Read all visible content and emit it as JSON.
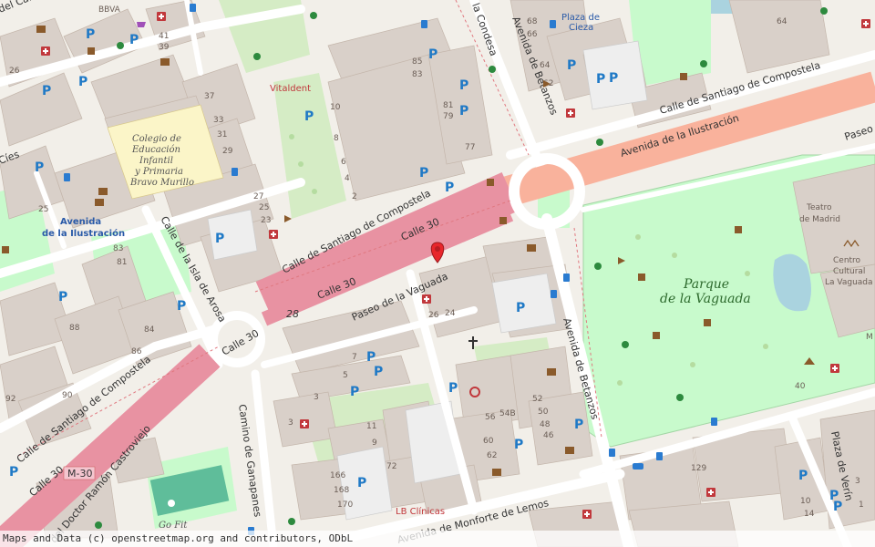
{
  "streets": {
    "calle_cardenal": "del Carden",
    "calle_condesa": "la Condesa",
    "avenida_betanzos_top": "Avenida de Betanzos",
    "calle_santiago_top": "Calle de Santiago de Compostela",
    "avenida_ilustracion_top": "Avenida de la Ilustración",
    "paseo_right": "Paseo",
    "cies": "Cíes",
    "calle_santiago_mid": "Calle de Santiago de Compostela",
    "calle_30_a": "Calle 30",
    "calle_30_b": "Calle 30",
    "calle_30_c": "Calle 30",
    "calle_30_d": "Calle 30",
    "calle_30_e": "Calle 30",
    "road_28": "28",
    "isla_arosa": "Calle de la Isla de Arosa",
    "paseo_vaguada": "Paseo de la Vaguada",
    "avenida_betanzos_mid": "Avenida de Betanzos",
    "calle_santiago_low": "Calle de Santiago de Compostela",
    "m30": "M-30",
    "doctor_ramon": "del Doctor Ramón Castroviejo",
    "camino_ganapanes": "Camino de Ganapanes",
    "monforte": "Avenida de Monforte de Lemos",
    "plaza_verin": "Plaza de Verín"
  },
  "places": {
    "bbva": "BBVA",
    "plaza_cieza_1": "Plaza de",
    "plaza_cieza_2": "Cieza",
    "vitaldent": "Vitaldent",
    "colegio_1": "Colegio de",
    "colegio_2": "Educación",
    "colegio_3": "Infantil",
    "colegio_4": "y Primaria",
    "colegio_5": "Bravo Murillo",
    "metro_1": "Avenida",
    "metro_2": "de la Ilustración",
    "parque_1": "Parque",
    "parque_2": "de la Vaguada",
    "teatro_1": "Teatro",
    "teatro_2": "de Madrid",
    "centro_1": "Centro",
    "centro_2": "Cultural",
    "centro_3": "La Vaguada",
    "lb_clinicas": "LB Clínicas",
    "go_fit": "Go Fit",
    "m_partial": "M"
  },
  "house_numbers": {
    "n41": "41",
    "n39": "39",
    "n26": "26",
    "n37": "37",
    "n33": "33",
    "n31": "31",
    "n29": "29",
    "n27": "27",
    "n25": "25",
    "n23": "23",
    "n85": "85",
    "n83": "83",
    "n81": "81",
    "n79": "79",
    "n77": "77",
    "n10": "10",
    "n8": "8",
    "n6": "6",
    "n4": "4",
    "n2": "2",
    "n68": "68",
    "n66": "66",
    "n64": "64",
    "n62": "62",
    "n64b": "64",
    "n83b": "83",
    "n81b": "81",
    "n84": "84",
    "n86": "86",
    "n88": "88",
    "n90": "90",
    "n92": "92",
    "n26b": "26",
    "n24": "24",
    "n7": "7",
    "n5": "5",
    "n3": "3",
    "n11": "11",
    "n9": "9",
    "n72": "72",
    "n3b": "3",
    "n166": "166",
    "n168": "168",
    "n170": "170",
    "n56": "56",
    "n54b": "54B",
    "n52": "52",
    "n50": "50",
    "n48": "48",
    "n46": "46",
    "n60": "60",
    "n62b": "62",
    "n40": "40",
    "n129": "129",
    "n10b": "10",
    "n14": "14",
    "n3c": "3",
    "n1": "1",
    "n25b": "25"
  },
  "attribution": "Maps and Data (c) openstreetmap.org and contributors, ODbL",
  "colors": {
    "background": "#f2efe9",
    "building": "#d9d0c9",
    "park": "#c8facc",
    "motorway": "#e892a2",
    "trunk": "#f9b29c",
    "road": "#ffffff",
    "marker": "#e8262c"
  },
  "icons": {
    "marker": "location-pin-icon",
    "parking": "parking-icon",
    "pharmacy": "pharmacy-cross-icon",
    "bus": "bus-stop-icon",
    "cafe": "cafe-icon",
    "playground": "playground-icon",
    "church": "christian-cross-icon",
    "theatre": "theatre-masks-icon"
  }
}
